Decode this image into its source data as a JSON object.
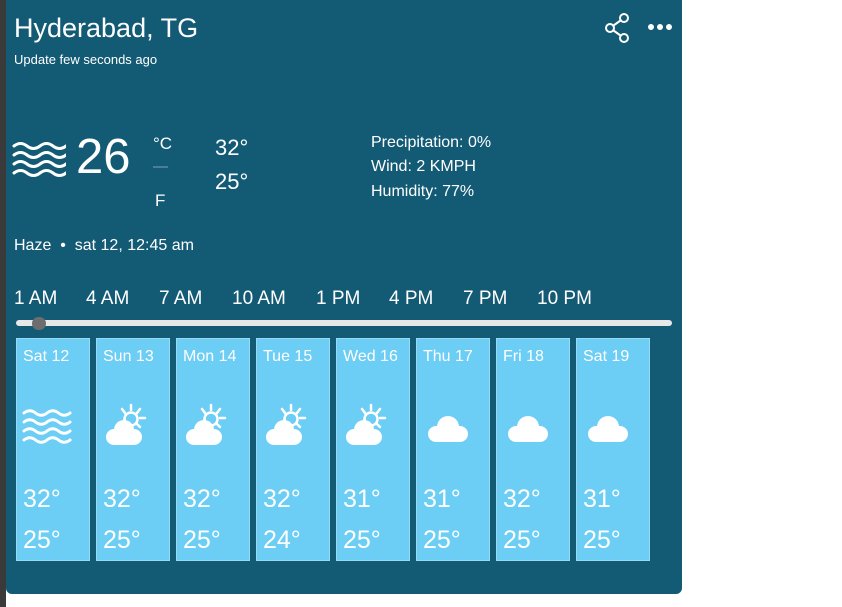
{
  "header": {
    "location": "Hyderabad, TG",
    "update_text": "Update few seconds ago",
    "share_icon": "share-icon",
    "more_icon": "more-options-icon"
  },
  "current": {
    "icon": "haze-icon",
    "temperature": "26",
    "unit_celsius": "°C",
    "unit_separator": "—",
    "unit_fahrenheit": "F",
    "high": "32°",
    "low": "25°",
    "precipitation": "Precipitation: 0%",
    "wind": "Wind: 2 KMPH",
    "humidity": "Humidity: 77%",
    "condition_line": "Haze  •  sat 12, 12:45 am"
  },
  "hours": [
    "1 AM",
    "4 AM",
    "7 AM",
    "10 AM",
    "1 PM",
    "4 PM",
    "7 PM",
    "10 PM"
  ],
  "slider": {
    "value_fraction": 0.03
  },
  "days": [
    {
      "name": "Sat 12",
      "icon": "haze-icon",
      "high": "32°",
      "low": "25°"
    },
    {
      "name": "Sun 13",
      "icon": "partly-sunny-icon",
      "high": "32°",
      "low": "25°"
    },
    {
      "name": "Mon 14",
      "icon": "partly-sunny-icon",
      "high": "32°",
      "low": "25°"
    },
    {
      "name": "Tue 15",
      "icon": "partly-sunny-icon",
      "high": "32°",
      "low": "24°"
    },
    {
      "name": "Wed 16",
      "icon": "partly-sunny-icon",
      "high": "31°",
      "low": "25°"
    },
    {
      "name": "Thu 17",
      "icon": "cloud-icon",
      "high": "31°",
      "low": "25°"
    },
    {
      "name": "Fri 18",
      "icon": "cloud-icon",
      "high": "32°",
      "low": "25°"
    },
    {
      "name": "Sat 19",
      "icon": "cloud-icon",
      "high": "31°",
      "low": "25°"
    }
  ],
  "colors": {
    "card_background": "#135a75",
    "day_card_background": "#6ccdf5",
    "text": "#ffffff",
    "slider_thumb": "#6d6d6d"
  }
}
